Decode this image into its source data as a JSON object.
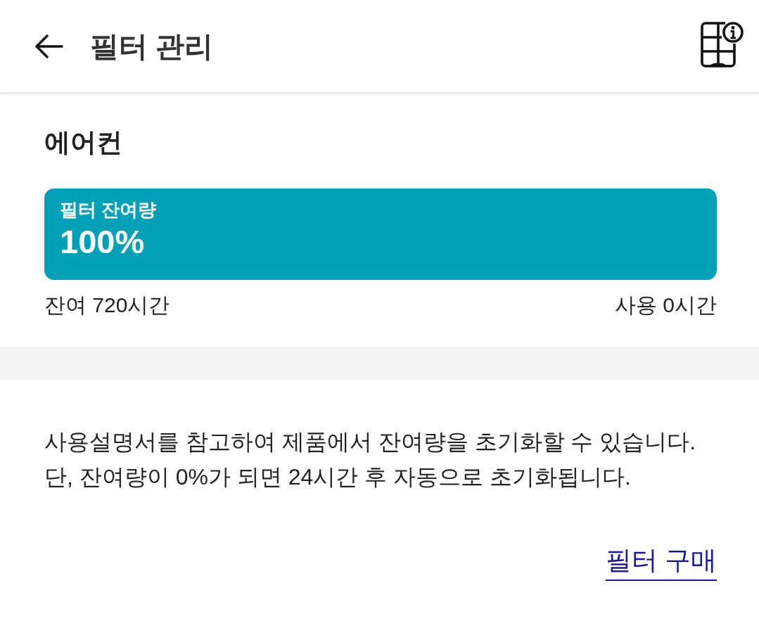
{
  "header": {
    "title": "필터 관리"
  },
  "appliance": {
    "name": "에어컨"
  },
  "filter": {
    "label": "필터 잔여량",
    "value": "100%",
    "level": 1,
    "remaining": "잔여 720시간",
    "used": "사용 0시간"
  },
  "notice": [
    "사용설명서를 참고하여 제품에서 잔여량을 초기화할 수 있습니다.",
    "단, 잔여량이 0%가 되면 24시간 후 자동으로 초기화됩니다."
  ],
  "purchase_link": "필터 구매"
}
